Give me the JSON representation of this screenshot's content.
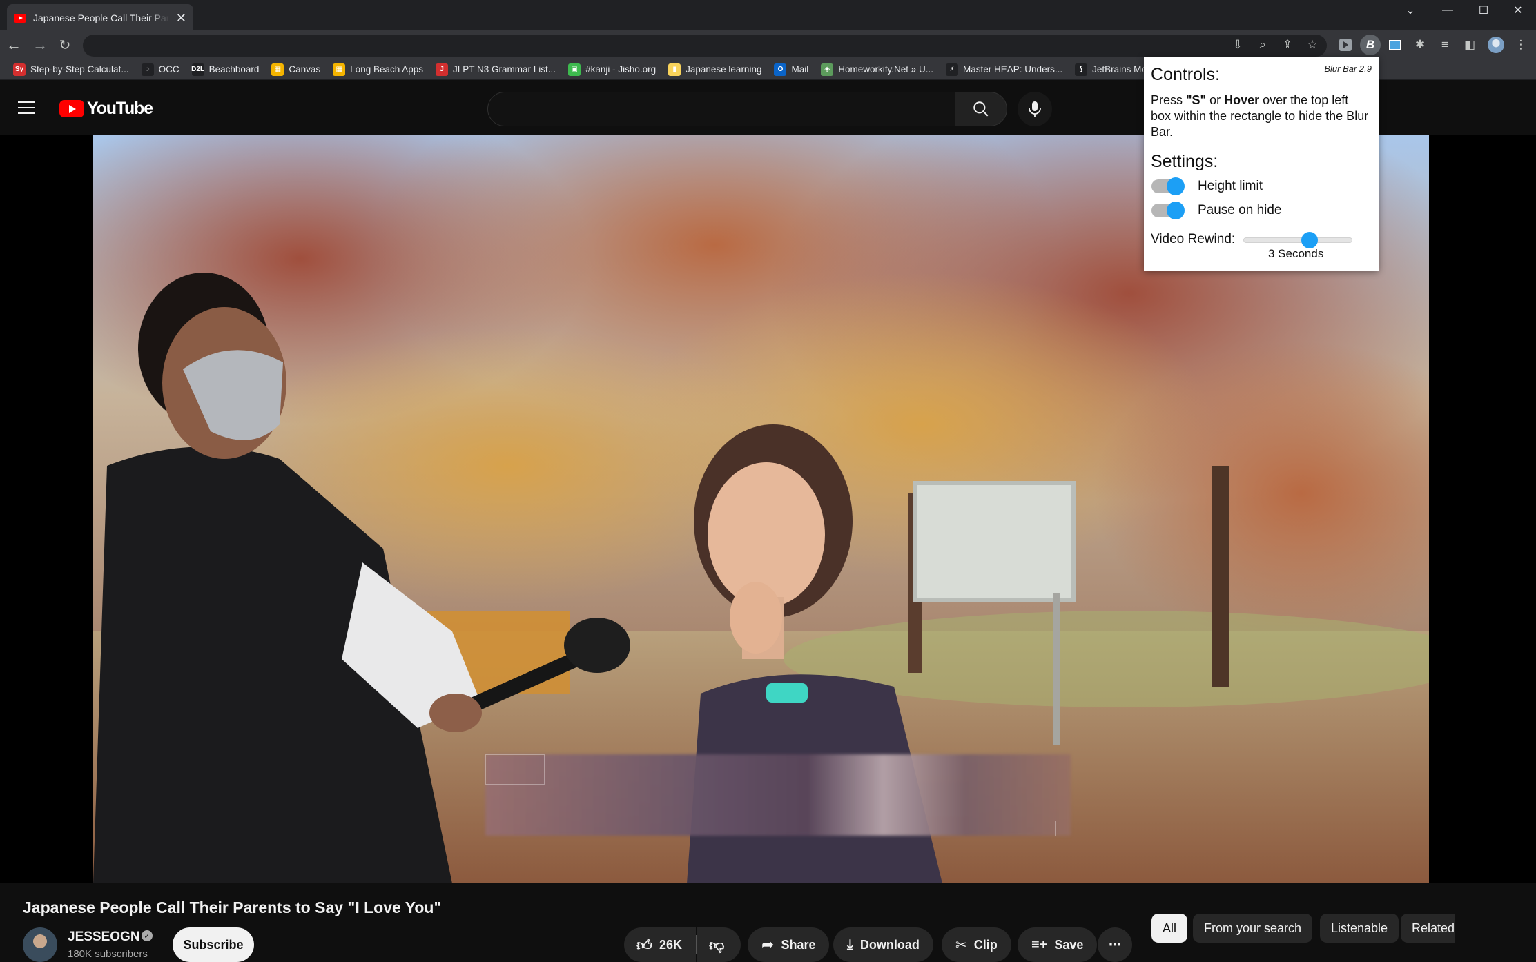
{
  "browser": {
    "tab_title": "Japanese People Call Their Parents to Say \"I Love You\"",
    "tab_close": "✕",
    "window_controls": [
      "⌄",
      "—",
      "☐",
      "✕"
    ],
    "address": "",
    "bookmarks": [
      {
        "label": "Step-by-Step Calculat...",
        "icon": "Sy",
        "color": "#d32f2f"
      },
      {
        "label": "OCC",
        "icon": "◌",
        "color": "#202124"
      },
      {
        "label": "Beachboard",
        "icon": "D2L",
        "color": "#202124"
      },
      {
        "label": "Canvas",
        "icon": "▦",
        "color": "#f4b400"
      },
      {
        "label": "Long Beach Apps",
        "icon": "▦",
        "color": "#f4b400"
      },
      {
        "label": "JLPT N3 Grammar List...",
        "icon": "J",
        "color": "#d32f2f"
      },
      {
        "label": "#kanji - Jisho.org",
        "icon": "▣",
        "color": "#3dba4e"
      },
      {
        "label": "Japanese learning",
        "icon": "▮",
        "color": "#f9d35b"
      },
      {
        "label": "Mail",
        "icon": "O",
        "color": "#0a64c8"
      },
      {
        "label": "Homeworkify.Net » U...",
        "icon": "◈",
        "color": "#5c9b5c"
      },
      {
        "label": "Master HEAP: Unders...",
        "icon": "⚡",
        "color": "#202124"
      },
      {
        "label": "JetBrains Mono: A fre...",
        "icon": "⟆",
        "color": "#202124"
      }
    ]
  },
  "youtube": {
    "logo_text": "YouTube",
    "search_placeholder": "",
    "video": {
      "title": "Japanese People Call Their Parents to Say \"I Love You\"",
      "channel": "JESSEOGN",
      "subscribers": "180K subscribers",
      "subscribe_label": "Subscribe",
      "likes": "26K",
      "share_label": "Share",
      "download_label": "Download",
      "clip_label": "Clip",
      "save_label": "Save",
      "more_label": "⋯"
    },
    "chips": [
      {
        "label": "All",
        "active": true
      },
      {
        "label": "From your search",
        "active": false
      },
      {
        "label": "Listenable",
        "active": false
      },
      {
        "label": "Related",
        "active": false
      }
    ]
  },
  "blur_bar_popup": {
    "version": "Blur Bar 2.9",
    "controls_heading": "Controls:",
    "desc_press": "Press ",
    "desc_key": "\"S\"",
    "desc_or": " or ",
    "desc_hover": "Hover",
    "desc_rest": " over the top left box within the rectangle to hide the Blur Bar.",
    "settings_heading": "Settings:",
    "toggles": [
      {
        "label": "Height limit",
        "on": true
      },
      {
        "label": "Pause on hide",
        "on": true
      }
    ],
    "rewind_label": "Video Rewind:",
    "rewind_value": "3 Seconds",
    "rewind_seconds": 3,
    "accent_color": "#1c9ff5"
  }
}
